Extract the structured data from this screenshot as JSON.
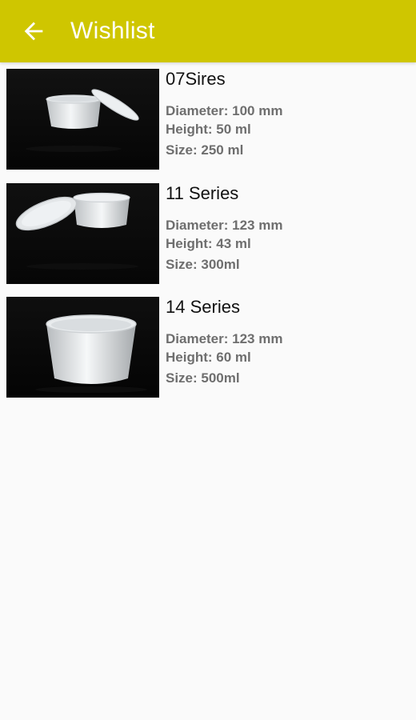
{
  "appbar": {
    "title": "Wishlist",
    "back_icon": "arrow-left-icon",
    "color": "#cfc600"
  },
  "items": [
    {
      "name": "07Sires",
      "diameter": "Diameter: 100 mm",
      "height": "Height: 50 ml",
      "size": "Size: 250 ml"
    },
    {
      "name": "11 Series",
      "diameter": "Diameter: 123 mm",
      "height": "Height: 43 ml",
      "size": "Size: 300ml"
    },
    {
      "name": "14 Series",
      "diameter": "Diameter: 123 mm",
      "height": "Height: 60 ml",
      "size": "Size: 500ml"
    }
  ]
}
